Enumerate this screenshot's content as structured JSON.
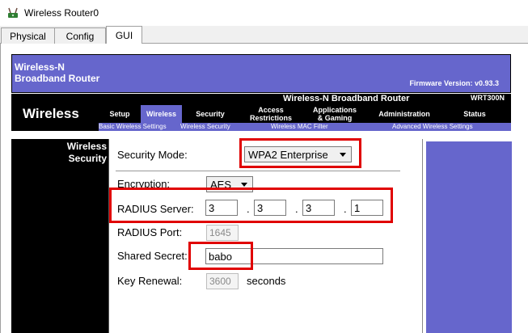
{
  "window": {
    "title": "Wireless Router0"
  },
  "tabs": [
    {
      "label": "Physical"
    },
    {
      "label": "Config"
    },
    {
      "label": "GUI"
    }
  ],
  "header": {
    "brand_line1": "Wireless-N",
    "brand_line2": "Broadband Router",
    "firmware": "Firmware Version: v0.93.3"
  },
  "nav": {
    "section": "Wireless",
    "product": "Wireless-N Broadband Router",
    "model": "WRT300N",
    "menu": [
      {
        "label": "Setup"
      },
      {
        "label": "Wireless"
      },
      {
        "label": "Security"
      },
      {
        "label": "Access Restrictions"
      },
      {
        "label": "Applications & Gaming"
      },
      {
        "label": "Administration"
      },
      {
        "label": "Status"
      }
    ],
    "submenu": [
      {
        "label": "Basic Wireless Settings"
      },
      {
        "label": "Wireless Security"
      },
      {
        "label": "Wireless MAC Filter"
      },
      {
        "label": "Advanced Wireless Settings"
      }
    ]
  },
  "sidebar": {
    "line1": "Wireless",
    "line2": "Security"
  },
  "form": {
    "security_mode_label": "Security Mode:",
    "security_mode_value": "WPA2 Enterprise",
    "encryption_label": "Encryption:",
    "encryption_value": "AES",
    "radius_server_label": "RADIUS Server:",
    "radius_ip": [
      "3",
      "3",
      "3",
      "1"
    ],
    "radius_dot": ".",
    "radius_port_label": "RADIUS Port:",
    "radius_port_value": "1645",
    "shared_secret_label": "Shared Secret:",
    "shared_secret_value": "babo",
    "key_renewal_label": "Key Renewal:",
    "key_renewal_value": "3600",
    "key_renewal_unit": "seconds"
  },
  "colors": {
    "accent": "#6666cc",
    "highlight_box": "#e00000",
    "nav_bg": "#000000"
  }
}
